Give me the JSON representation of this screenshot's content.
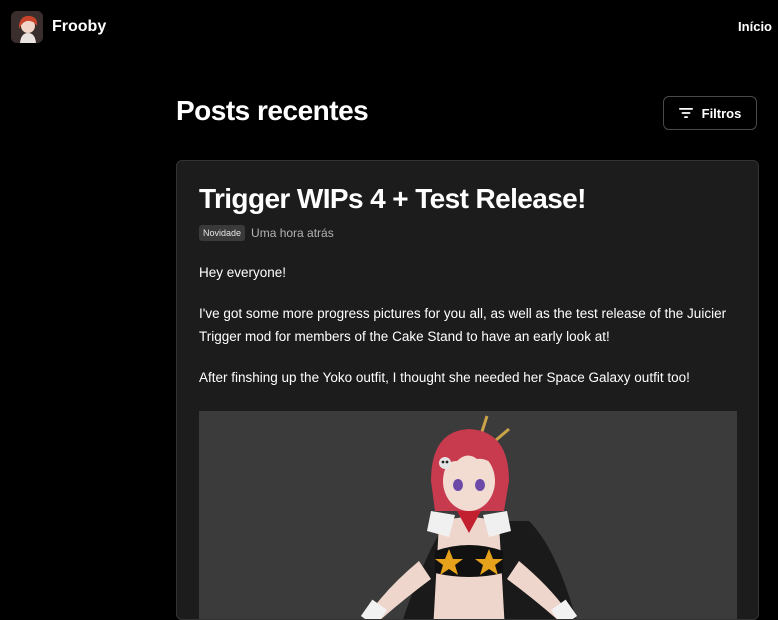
{
  "header": {
    "brand_name": "Frooby",
    "nav_home": "Início"
  },
  "main": {
    "title": "Posts recentes",
    "filter_label": "Filtros"
  },
  "post": {
    "title": "Trigger WIPs 4 + Test Release!",
    "badge": "Novidade",
    "time": "Uma hora atrás",
    "paragraphs": [
      "Hey everyone!",
      "I've got some more progress pictures for you all, as well as the test release of the Juicier Trigger mod for members of the Cake Stand to have an early look at!",
      "After finshing up the Yoko outfit, I thought she needed her Space Galaxy outfit too!"
    ]
  },
  "colors": {
    "background": "#000000",
    "card": "#1c1c1c",
    "image_bg": "#3b3b3b"
  }
}
